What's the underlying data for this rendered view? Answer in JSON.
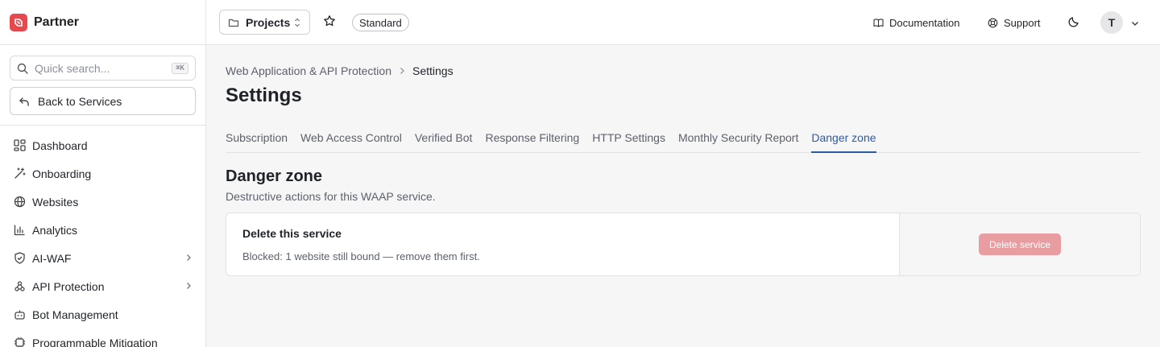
{
  "sidebar": {
    "brand": "Partner",
    "search": {
      "placeholder": "Quick search...",
      "shortcut": "⌘K"
    },
    "back_label": "Back to Services",
    "items": [
      {
        "label": "Dashboard",
        "icon": "dashboard-icon"
      },
      {
        "label": "Onboarding",
        "icon": "wand-icon"
      },
      {
        "label": "Websites",
        "icon": "globe-icon"
      },
      {
        "label": "Analytics",
        "icon": "chart-icon"
      },
      {
        "label": "AI-WAF",
        "icon": "shield-icon",
        "expandable": true
      },
      {
        "label": "API Protection",
        "icon": "webhook-icon",
        "expandable": true
      },
      {
        "label": "Bot Management",
        "icon": "bot-icon"
      },
      {
        "label": "Programmable Mitigation",
        "icon": "cpu-icon"
      }
    ]
  },
  "topbar": {
    "project_label": "Projects",
    "plan_badge": "Standard",
    "documentation": "Documentation",
    "support": "Support",
    "avatar_initial": "T"
  },
  "main": {
    "breadcrumb": [
      "Web Application & API Protection",
      "Settings"
    ],
    "title": "Settings",
    "tabs": [
      {
        "label": "Subscription",
        "active": false
      },
      {
        "label": "Web Access Control",
        "active": false
      },
      {
        "label": "Verified Bot",
        "active": false
      },
      {
        "label": "Response Filtering",
        "active": false
      },
      {
        "label": "HTTP Settings",
        "active": false
      },
      {
        "label": "Monthly Security Report",
        "active": false
      },
      {
        "label": "Danger zone",
        "active": true
      }
    ],
    "section": {
      "title": "Danger zone",
      "subtitle": "Destructive actions for this WAAP service.",
      "card": {
        "title": "Delete this service",
        "description": "Blocked: 1 website still bound — remove them first.",
        "button": "Delete service",
        "button_disabled": true
      }
    }
  },
  "colors": {
    "accent": "#2b5aa8",
    "brand": "#e5484d",
    "danger_disabled": "#e89da0"
  }
}
